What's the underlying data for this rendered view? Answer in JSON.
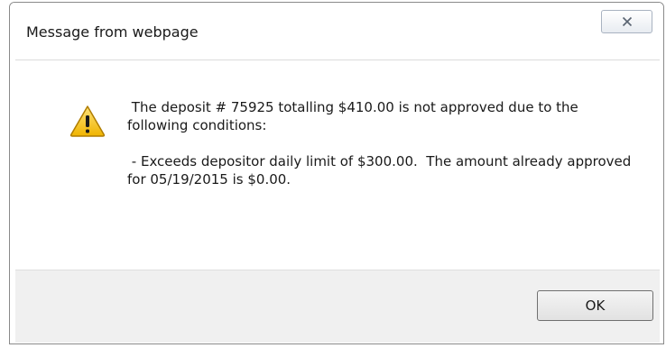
{
  "dialog": {
    "title": "Message from webpage",
    "close_icon": "close-x-icon",
    "warning_icon": "warning-triangle-icon",
    "message_line1": " The deposit # 75925 totalling $410.00 is not approved due to the following conditions:",
    "message_line2": " - Exceeds depositor daily limit of $300.00.  The amount already approved for 05/19/2015 is $0.00.",
    "ok_label": "OK"
  },
  "colors": {
    "warning_fill": "#f5c518",
    "footer_bg": "#f0f0f0"
  }
}
